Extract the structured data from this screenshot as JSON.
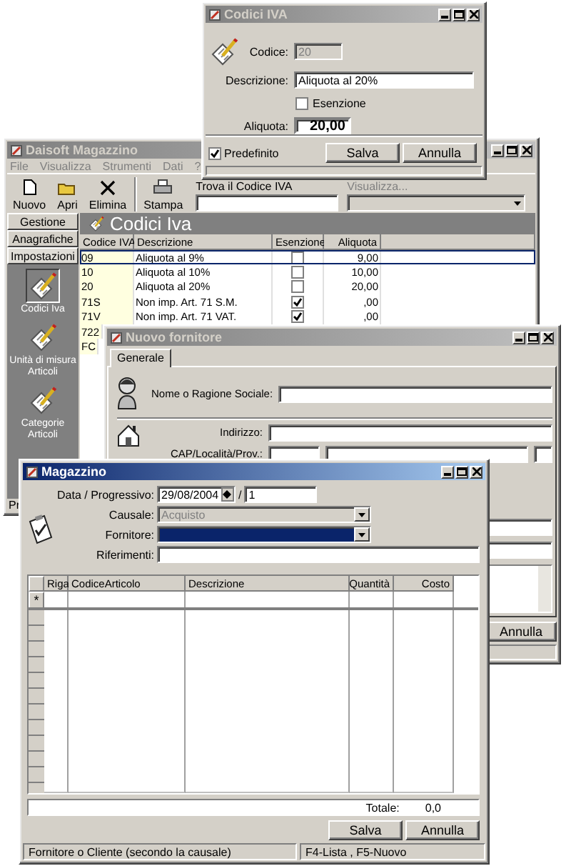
{
  "iva_dialog": {
    "title": "Codici IVA",
    "active": false,
    "codice": {
      "label": "Codice:",
      "value": "20",
      "disabled": true
    },
    "descrizione": {
      "label": "Descrizione:",
      "value": "Aliquota al 20%"
    },
    "esenzione": {
      "label": "Esenzione",
      "checked": false
    },
    "aliquota": {
      "label": "Aliquota:",
      "value": "20,00"
    },
    "predefinito": {
      "label": "Predefinito",
      "checked": true
    },
    "buttons": [
      "Salva",
      "Annulla"
    ]
  },
  "main_window": {
    "title": "Daisoft Magazzino",
    "active": false,
    "menu": [
      "File",
      "Visualizza",
      "Strumenti",
      "Dati",
      "?"
    ],
    "toolbar": [
      {
        "label": "Nuovo",
        "kind": "page"
      },
      {
        "label": "Apri",
        "kind": "folder"
      },
      {
        "label": "Elimina",
        "kind": "delete"
      },
      {
        "label": "Stampa",
        "kind": "printer"
      }
    ],
    "search": {
      "label": "Trova il Codice IVA"
    },
    "view": {
      "label": "Visualizza...",
      "disabled": true
    },
    "sidebar_tabs": [
      {
        "label": "Gestione",
        "selected": false
      },
      {
        "label": "Anagrafiche",
        "selected": false
      },
      {
        "label": "Impostazioni",
        "selected": true
      }
    ],
    "sidebar_items": [
      {
        "label": "Codici Iva",
        "selected": true
      },
      {
        "label": "Unità di misura Articoli",
        "selected": false
      },
      {
        "label": "Categorie Articoli",
        "selected": false
      }
    ],
    "header": "Codici Iva",
    "columns": [
      "Codice IVA",
      "Descrizione",
      "Esenzione",
      "Aliquota"
    ],
    "rows": [
      {
        "code": "09",
        "description": "Aliquota al 9%",
        "exempt": false,
        "rate": "9,00",
        "selected": true
      },
      {
        "code": "10",
        "description": "Aliquota al 10%",
        "exempt": false,
        "rate": "10,00",
        "selected": false
      },
      {
        "code": "20",
        "description": "Aliquota al 20%",
        "exempt": false,
        "rate": "20,00",
        "selected": false
      },
      {
        "code": "71S",
        "description": "Non imp. Art. 71 S.M.",
        "exempt": true,
        "rate": ",00",
        "selected": false
      },
      {
        "code": "71V",
        "description": "Non imp. Art. 71 VAT.",
        "exempt": true,
        "rate": ",00",
        "selected": false
      },
      {
        "code": "722",
        "selected": false
      },
      {
        "code": "FC",
        "selected": false
      }
    ],
    "status_text": "Pr"
  },
  "supplier_window": {
    "title": "Nuovo fornitore",
    "active": false,
    "tabs": [
      {
        "label": "Generale",
        "selected": true
      }
    ],
    "name_label": "Nome o Ragione Sociale:",
    "address_label": "Indirizzo:",
    "city_label": "CAP/Località/Prov.:",
    "buttons": [
      "Annulla"
    ]
  },
  "magazzino_window": {
    "title": "Magazzino",
    "active": true,
    "date_label": "Data / Progressivo:",
    "date": "29/08/2004",
    "separator": "/",
    "number": "1",
    "causale": {
      "label": "Causale:",
      "value": "Acquisto",
      "disabled": true
    },
    "fornitore": {
      "label": "Fornitore:",
      "focused": true
    },
    "riferimenti": {
      "label": "Riferimenti:"
    },
    "columns": [
      "Riga",
      "CodiceArticolo",
      "Descrizione",
      "Quantità",
      "Costo"
    ],
    "new_row_marker": "*",
    "total_label": "Totale:",
    "total": "0,0",
    "buttons": [
      "Salva",
      "Annulla"
    ],
    "status": [
      "Fornitore o Cliente (secondo la causale)",
      "F4-Lista , F5-Nuovo"
    ]
  }
}
